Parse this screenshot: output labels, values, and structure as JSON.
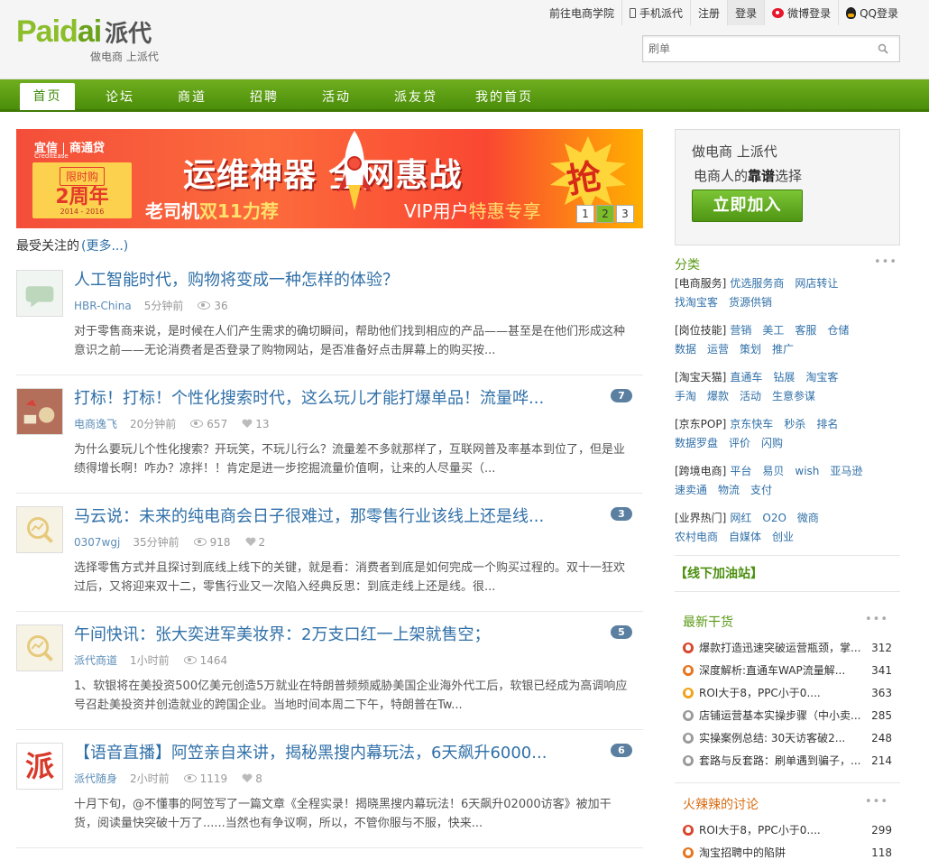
{
  "brand": {
    "logo_en": "Paidai",
    "logo_cn": "派代",
    "slogan": "做电商 上派代"
  },
  "toplinks": [
    {
      "label": "前往电商学院",
      "icon": ""
    },
    {
      "label": "手机派代",
      "icon": "phone-icon"
    },
    {
      "label": "注册",
      "icon": ""
    },
    {
      "label": "登录",
      "icon": ""
    },
    {
      "label": "微博登录",
      "icon": "weibo-icon"
    },
    {
      "label": "QQ登录",
      "icon": "qq-icon"
    }
  ],
  "search": {
    "placeholder": "刷单"
  },
  "nav": [
    "首页",
    "论坛",
    "商道",
    "招聘",
    "活动",
    "派友贷",
    "我的首页"
  ],
  "banner": {
    "brand_a": "宜信",
    "brand_a_sub": "CreditEase",
    "brand_b": "商通贷",
    "badge_1": "限时购",
    "badge_2": "2周年",
    "badge_3": "2014 - 2016",
    "title": "运维神器 全网惠战",
    "line1_pre": "老司机",
    "line1_hl": "双11力荐",
    "line2_pre": "VIP用户",
    "line2_hl": "特惠专享",
    "grab": "抢",
    "pages": [
      "1",
      "2",
      "3"
    ],
    "active_page": "2"
  },
  "feed": {
    "heading": "最受关注的",
    "more": "(更多...)",
    "posts": [
      {
        "title": "人工智能时代，购物将变成一种怎样的体验？",
        "source": "HBR-China",
        "time": "5分钟前",
        "views": "36",
        "likes": "",
        "comments": "",
        "excerpt": "对于零售商来说，是时候在人们产生需求的确切瞬间，帮助他们找到相应的产品——甚至是在他们形成这种意识之前——无论消费者是否登录了购物网站，是否准备好点击屏幕上的购买按..."
      },
      {
        "title": "打标！打标！个性化搜索时代，这么玩儿才能打爆单品！流量哗...",
        "source": "电商逸飞",
        "time": "20分钟前",
        "views": "657",
        "likes": "13",
        "comments": "7",
        "excerpt": "为什么要玩儿个性化搜索？开玩笑，不玩儿行么？流量差不多就那样了，互联网普及率基本到位了，但是业绩得增长啊！咋办？凉拌！！肯定是进一步挖掘流量价值啊，让来的人尽量买（..."
      },
      {
        "title": "马云说：未来的纯电商会日子很难过，那零售行业该线上还是线...",
        "source": "0307wgj",
        "time": "35分钟前",
        "views": "918",
        "likes": "2",
        "comments": "3",
        "excerpt": "选择零售方式并且探讨到底线上线下的关键，就是看：消费者到底是如何完成一个购买过程的。双十一狂欢过后，又将迎来双十二，零售行业又一次陷入经典反思：到底走线上还是线。很..."
      },
      {
        "title": "午间快讯：张大奕进军美妆界：2万支口红一上架就售空；",
        "source": "派代商道",
        "time": "1小时前",
        "views": "1464",
        "likes": "",
        "comments": "5",
        "excerpt": "1、软银将在美投资500亿美元创造5万就业在特朗普频频威胁美国企业海外代工后，软银已经成为高调响应号召赴美投资并创造就业的跨国企业。当地时间本周二下午，特朗普在Tw..."
      },
      {
        "title": "【语音直播】阿笠亲自来讲，揭秘黑搜内幕玩法，6天飙升6000...",
        "source": "派代随身",
        "time": "2小时前",
        "views": "1119",
        "likes": "8",
        "comments": "6",
        "excerpt": "十月下旬，@不懂事的阿笠写了一篇文章《全程实录！揭晓黑搜内幕玩法！6天飙升02000访客》被加干货，阅读量快突破十万了......当然也有争议啊，所以，不管你服与不服，快来..."
      }
    ]
  },
  "sidebar": {
    "join": {
      "line1": "做电商 上派代",
      "line2_pre": "电商人的",
      "line2_bold": "靠谱",
      "line2_post": "选择",
      "button": "立即加入"
    },
    "cats_title": "分类",
    "more": "•••",
    "cats": [
      {
        "head": "[电商服务]",
        "tags": [
          "优选服务商",
          "网店转让",
          "找淘宝客",
          "货源供销"
        ]
      },
      {
        "head": "[岗位技能]",
        "tags": [
          "营销",
          "美工",
          "客服",
          "仓储",
          "数据",
          "运营",
          "策划",
          "推广"
        ]
      },
      {
        "head": "[淘宝天猫]",
        "tags": [
          "直通车",
          "钻展",
          "淘宝客",
          "手淘",
          "爆款",
          "活动",
          "生意参谋"
        ]
      },
      {
        "head": "[京东POP]",
        "tags": [
          "京东快车",
          "秒杀",
          "排名",
          "数据罗盘",
          "评价",
          "闪购"
        ]
      },
      {
        "head": "[跨境电商]",
        "tags": [
          "平台",
          "易贝",
          "wish",
          "亚马逊",
          "速卖通",
          "物流",
          "支付"
        ]
      },
      {
        "head": "[业界热门]",
        "tags": [
          "网红",
          "O2O",
          "微商",
          "农村电商",
          "自媒体",
          "创业"
        ]
      }
    ],
    "offline": "【线下加油站】",
    "latest_title": "最新干货",
    "latest": [
      {
        "title": "爆款打造迅速突破运营瓶颈，掌...",
        "num": "312",
        "color": "#d9442a"
      },
      {
        "title": "深度解析:直通车WAP流量解...",
        "num": "341",
        "color": "#e8731c"
      },
      {
        "title": "ROI大于8，PPC小于0....",
        "num": "363",
        "color": "#f1a21a"
      },
      {
        "title": "店铺运营基本实操步骤（中小卖...",
        "num": "285",
        "color": "#9a9a9a"
      },
      {
        "title": "实操案例总结: 30天访客破2...",
        "num": "248",
        "color": "#9a9a9a"
      },
      {
        "title": "套路与反套路：刷单遇到骗子，...",
        "num": "214",
        "color": "#9a9a9a"
      }
    ],
    "hot_title": "火辣辣的讨论",
    "hot": [
      {
        "title": "ROI大于8，PPC小于0....",
        "num": "299",
        "color": "#d9442a"
      },
      {
        "title": "淘宝招聘中的陷阱",
        "num": "118",
        "color": "#e8731c"
      }
    ]
  }
}
